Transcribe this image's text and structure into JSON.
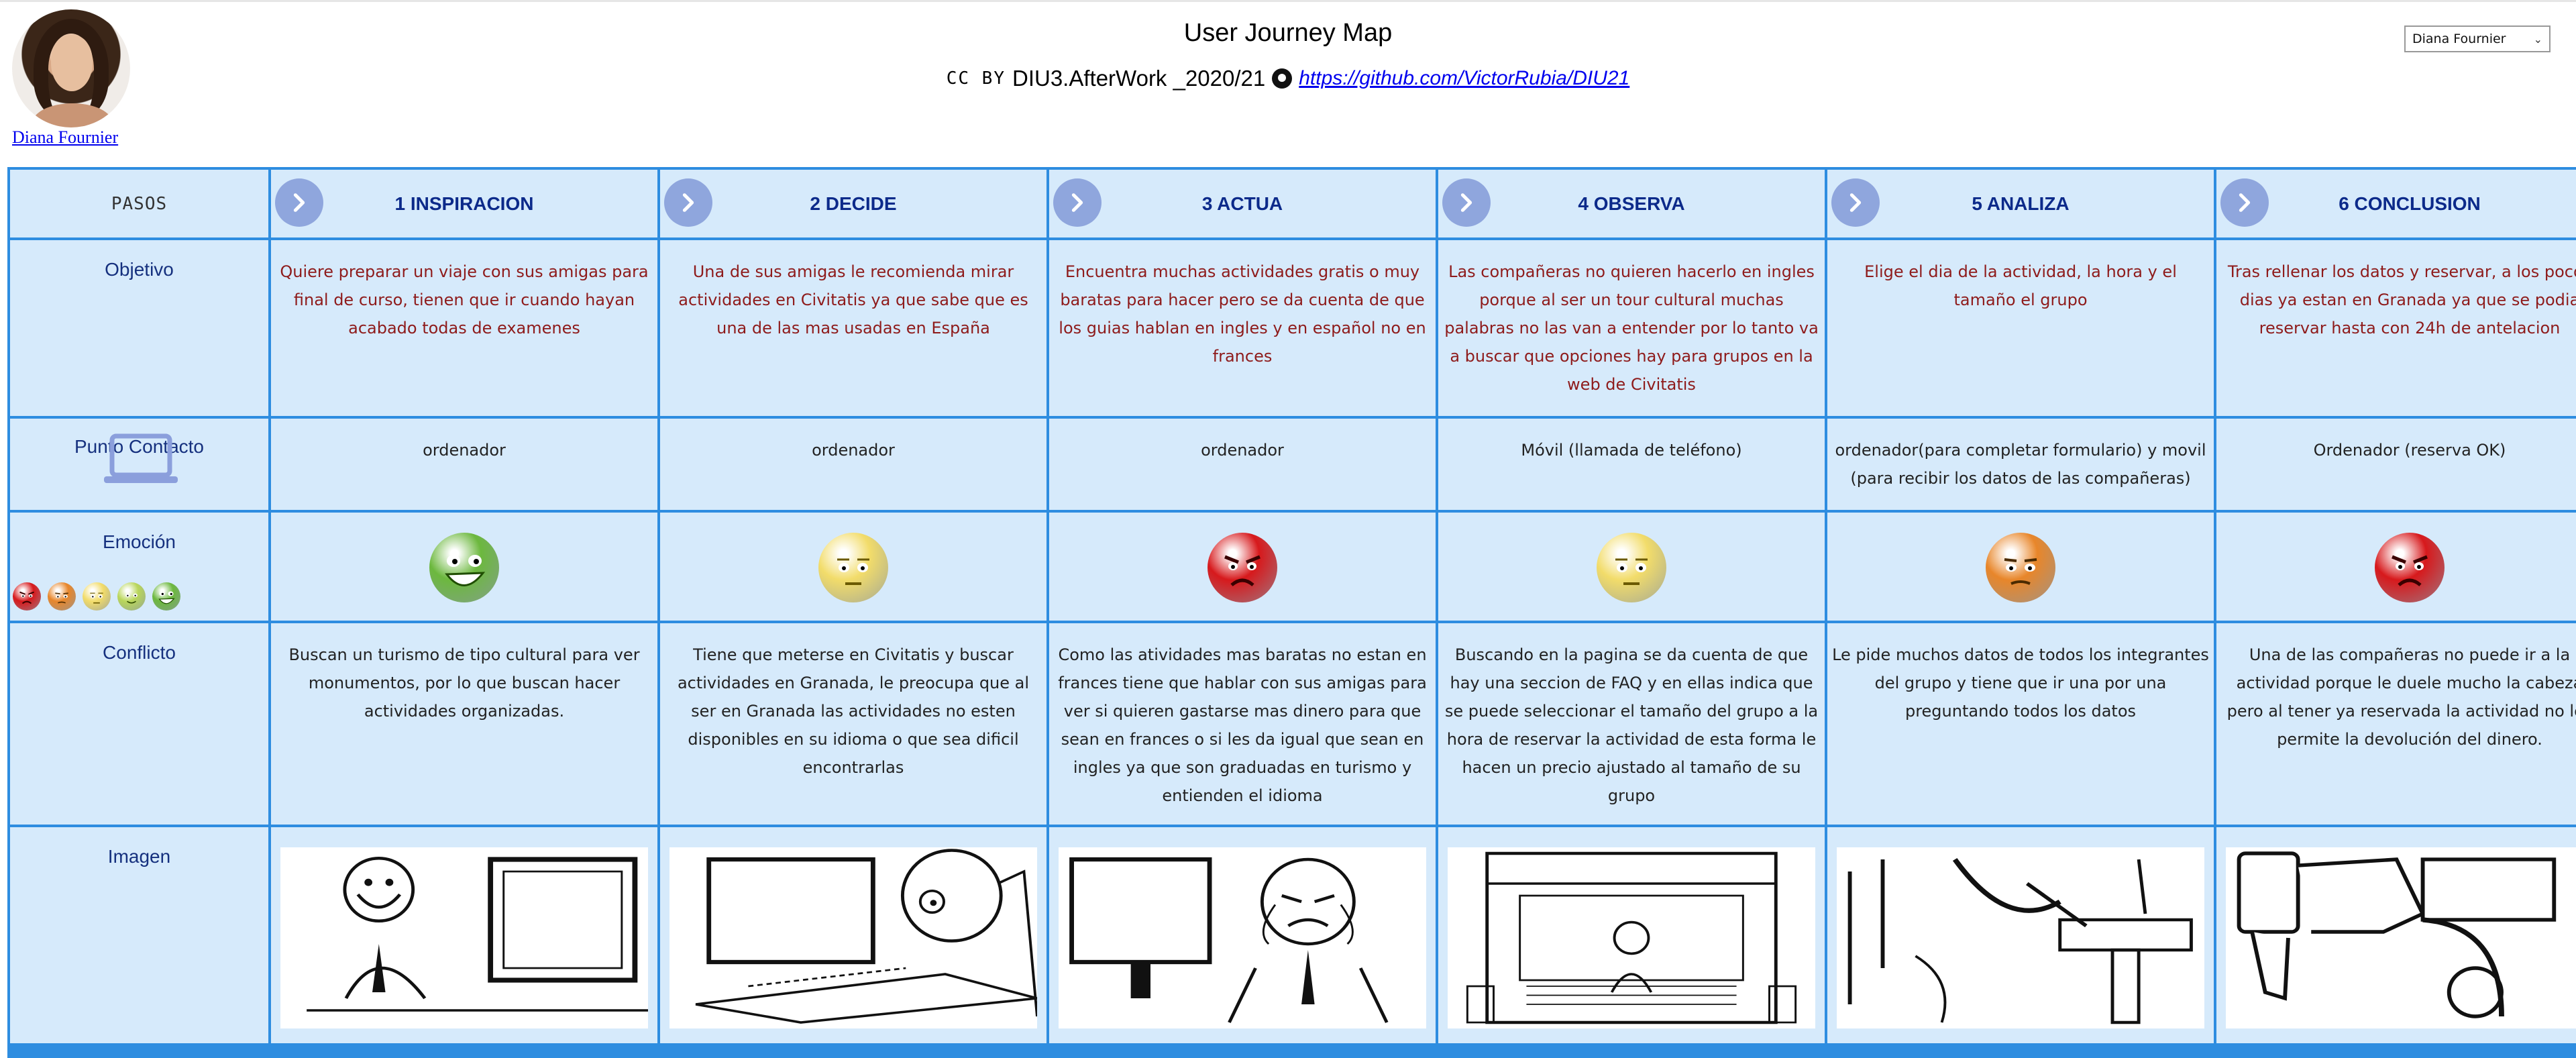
{
  "header": {
    "title": "User Journey Map",
    "license_text": "CC BY",
    "course_text": "DIU3.AfterWork _2020/21",
    "repo_link": "https://github.com/VictorRubia/DIU21",
    "user_name": "Diana Fournier",
    "selected_user": "Diana Fournier"
  },
  "row_labels": {
    "pasos": "PASOS",
    "objetivo": "Objetivo",
    "punto_contacto": "Punto Contacto",
    "emocion": "Emoción",
    "conflicto": "Conflicto",
    "imagen": "Imagen"
  },
  "stages": [
    {
      "title": "1 INSPIRACION",
      "objetivo": "Quiere preparar un viaje con sus amigas para final de curso, tienen que ir cuando hayan acabado todas de examenes",
      "contacto": "ordenador",
      "emotion": "very-happy",
      "conflicto": "Buscan un turismo de tipo cultural para ver monumentos, por lo que buscan hacer actividades organizadas."
    },
    {
      "title": "2 DECIDE",
      "objetivo": "Una de sus amigas le recomienda mirar actividades en Civitatis ya que sabe que es una de las mas usadas en España",
      "contacto": "ordenador",
      "emotion": "neutral",
      "conflicto": "Tiene que meterse en Civitatis y buscar actividades en Granada, le preocupa que al ser en Granada las actividades no esten disponibles en su idioma o que sea dificil encontrarlas"
    },
    {
      "title": "3 ACTUA",
      "objetivo": "Encuentra muchas actividades gratis o muy baratas para hacer pero se da cuenta de que los guias hablan en ingles y en español no en frances",
      "contacto": "ordenador",
      "emotion": "angry",
      "conflicto": "Como las atividades mas baratas no estan en frances tiene que hablar con sus amigas para ver si quieren gastarse mas dinero para que sean en frances o si les da igual que sean en ingles ya que son graduadas en turismo y entienden el idioma"
    },
    {
      "title": "4 OBSERVA",
      "objetivo": "Las compañeras no quieren hacerlo en ingles porque al ser un tour cultural muchas palabras no las van a entender por lo tanto va a buscar que opciones hay para grupos en la web de Civitatis",
      "contacto": "Móvil (llamada de teléfono)",
      "emotion": "neutral",
      "conflicto": "Buscando en la pagina se da cuenta de que hay una seccion de FAQ y en ellas indica que se puede seleccionar el tamaño del grupo a la hora de reservar la actividad de esta forma le hacen un precio ajustado al tamaño de su grupo"
    },
    {
      "title": "5 ANALIZA",
      "objetivo": "Elige el dia de la actividad, la hora y el tamaño el grupo",
      "contacto": "ordenador(para completar formulario) y movil (para recibir los datos de las compañeras)",
      "emotion": "annoyed",
      "conflicto": "Le pide muchos datos de todos los integrantes del grupo y tiene que ir una por una preguntando todos los datos"
    },
    {
      "title": "6 CONCLUSION",
      "objetivo": "Tras rellenar los datos y reservar, a los pocos dias ya estan en Granada ya que se podia reservar hasta con 24h de antelacion",
      "contacto": "Ordenador (reserva OK)",
      "emotion": "angry",
      "conflicto": "Una de las compañeras no puede ir a la actividad porque le duele mucho la cabeza pero al tener ya reservada la actividad no les permite la devolución del dinero."
    }
  ],
  "emotion_legend": [
    "angry",
    "annoyed",
    "neutral",
    "happy",
    "very-happy"
  ],
  "emotion_colors": {
    "angry": "#d7191c",
    "annoyed": "#e8862a",
    "neutral": "#f2dc6a",
    "happy": "#b9d65a",
    "very-happy": "#6cb83e"
  },
  "colors": {
    "grid_border": "#2e8de0",
    "cell_bg": "#d6eafb",
    "stage_title": "#0c2a8a",
    "objective_text": "#8e1b1b",
    "link": "#0000ee"
  }
}
